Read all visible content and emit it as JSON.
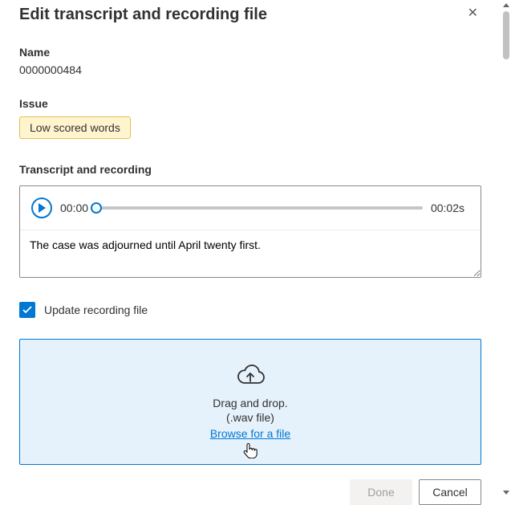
{
  "dialog": {
    "title": "Edit transcript and recording file",
    "close_icon": "✕"
  },
  "name": {
    "label": "Name",
    "value": "0000000484"
  },
  "issue": {
    "label": "Issue",
    "tag": "Low scored words"
  },
  "transcript": {
    "label": "Transcript and recording",
    "current_time": "00:00",
    "duration": "00:02s",
    "text": "The case was adjourned until April twenty first."
  },
  "update_checkbox": {
    "label": "Update recording file",
    "checked": true
  },
  "dropzone": {
    "line1": "Drag and drop.",
    "line2": "(.wav file)",
    "browse": "Browse for a file"
  },
  "footer": {
    "done": "Done",
    "cancel": "Cancel"
  }
}
